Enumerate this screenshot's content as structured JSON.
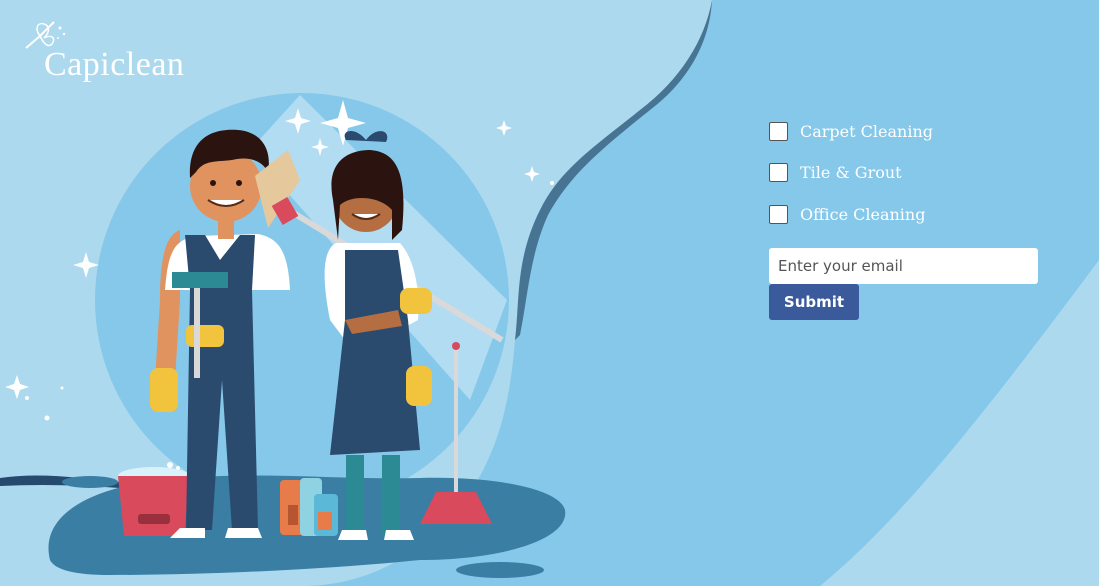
{
  "brand": {
    "name": "Capiclean",
    "logo_icon": "duster-icon"
  },
  "services": [
    {
      "label": "Carpet Cleaning",
      "checked": false
    },
    {
      "label": "Tile & Grout",
      "checked": false
    },
    {
      "label": "Office Cleaning",
      "checked": false
    }
  ],
  "form": {
    "email_placeholder": "Enter your email",
    "email_value": "",
    "submit_label": "Submit"
  },
  "colors": {
    "background": "#86c8ea",
    "panel_light": "#acd9ee",
    "submit": "#3a5a9c",
    "navy": "#2a4a6e"
  }
}
